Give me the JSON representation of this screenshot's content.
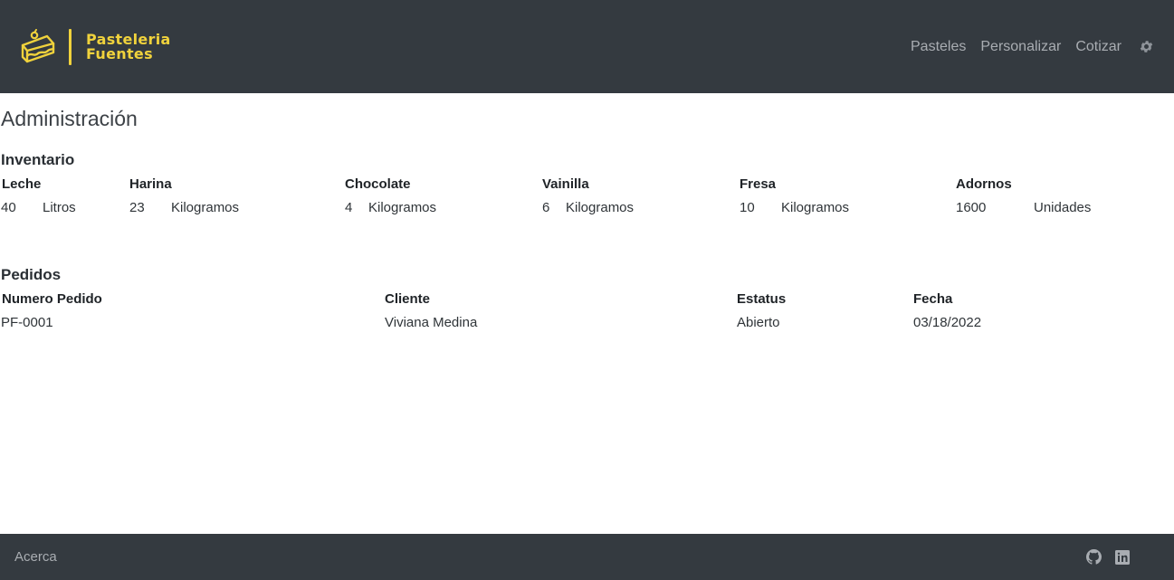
{
  "brand": {
    "line1": "Pasteleria",
    "line2": "Fuentes",
    "color": "#f0d23c"
  },
  "nav": {
    "links": [
      "Pasteles",
      "Personalizar",
      "Cotizar"
    ],
    "settings_icon": "gear-icon"
  },
  "page": {
    "title": "Administración"
  },
  "inventario": {
    "title": "Inventario",
    "items": [
      {
        "name": "Leche",
        "qty": "40",
        "unit": "Litros"
      },
      {
        "name": "Harina",
        "qty": "23",
        "unit": "Kilogramos"
      },
      {
        "name": "Chocolate",
        "qty": "4",
        "unit": "Kilogramos"
      },
      {
        "name": "Vainilla",
        "qty": "6",
        "unit": "Kilogramos"
      },
      {
        "name": "Fresa",
        "qty": "10",
        "unit": "Kilogramos"
      },
      {
        "name": "Adornos",
        "qty": "1600",
        "unit": "Unidades"
      }
    ]
  },
  "pedidos": {
    "title": "Pedidos",
    "columns": [
      "Numero Pedido",
      "Cliente",
      "Estatus",
      "Fecha"
    ],
    "rows": [
      [
        "PF-0001",
        "Viviana Medina",
        "Abierto",
        "03/18/2022"
      ]
    ]
  },
  "footer": {
    "link": "Acerca",
    "icons": [
      "github-icon",
      "linkedin-icon"
    ]
  },
  "colors": {
    "navbar": "#343a40",
    "nav_text": "#a9adb2",
    "accent": "#f0d23c"
  }
}
